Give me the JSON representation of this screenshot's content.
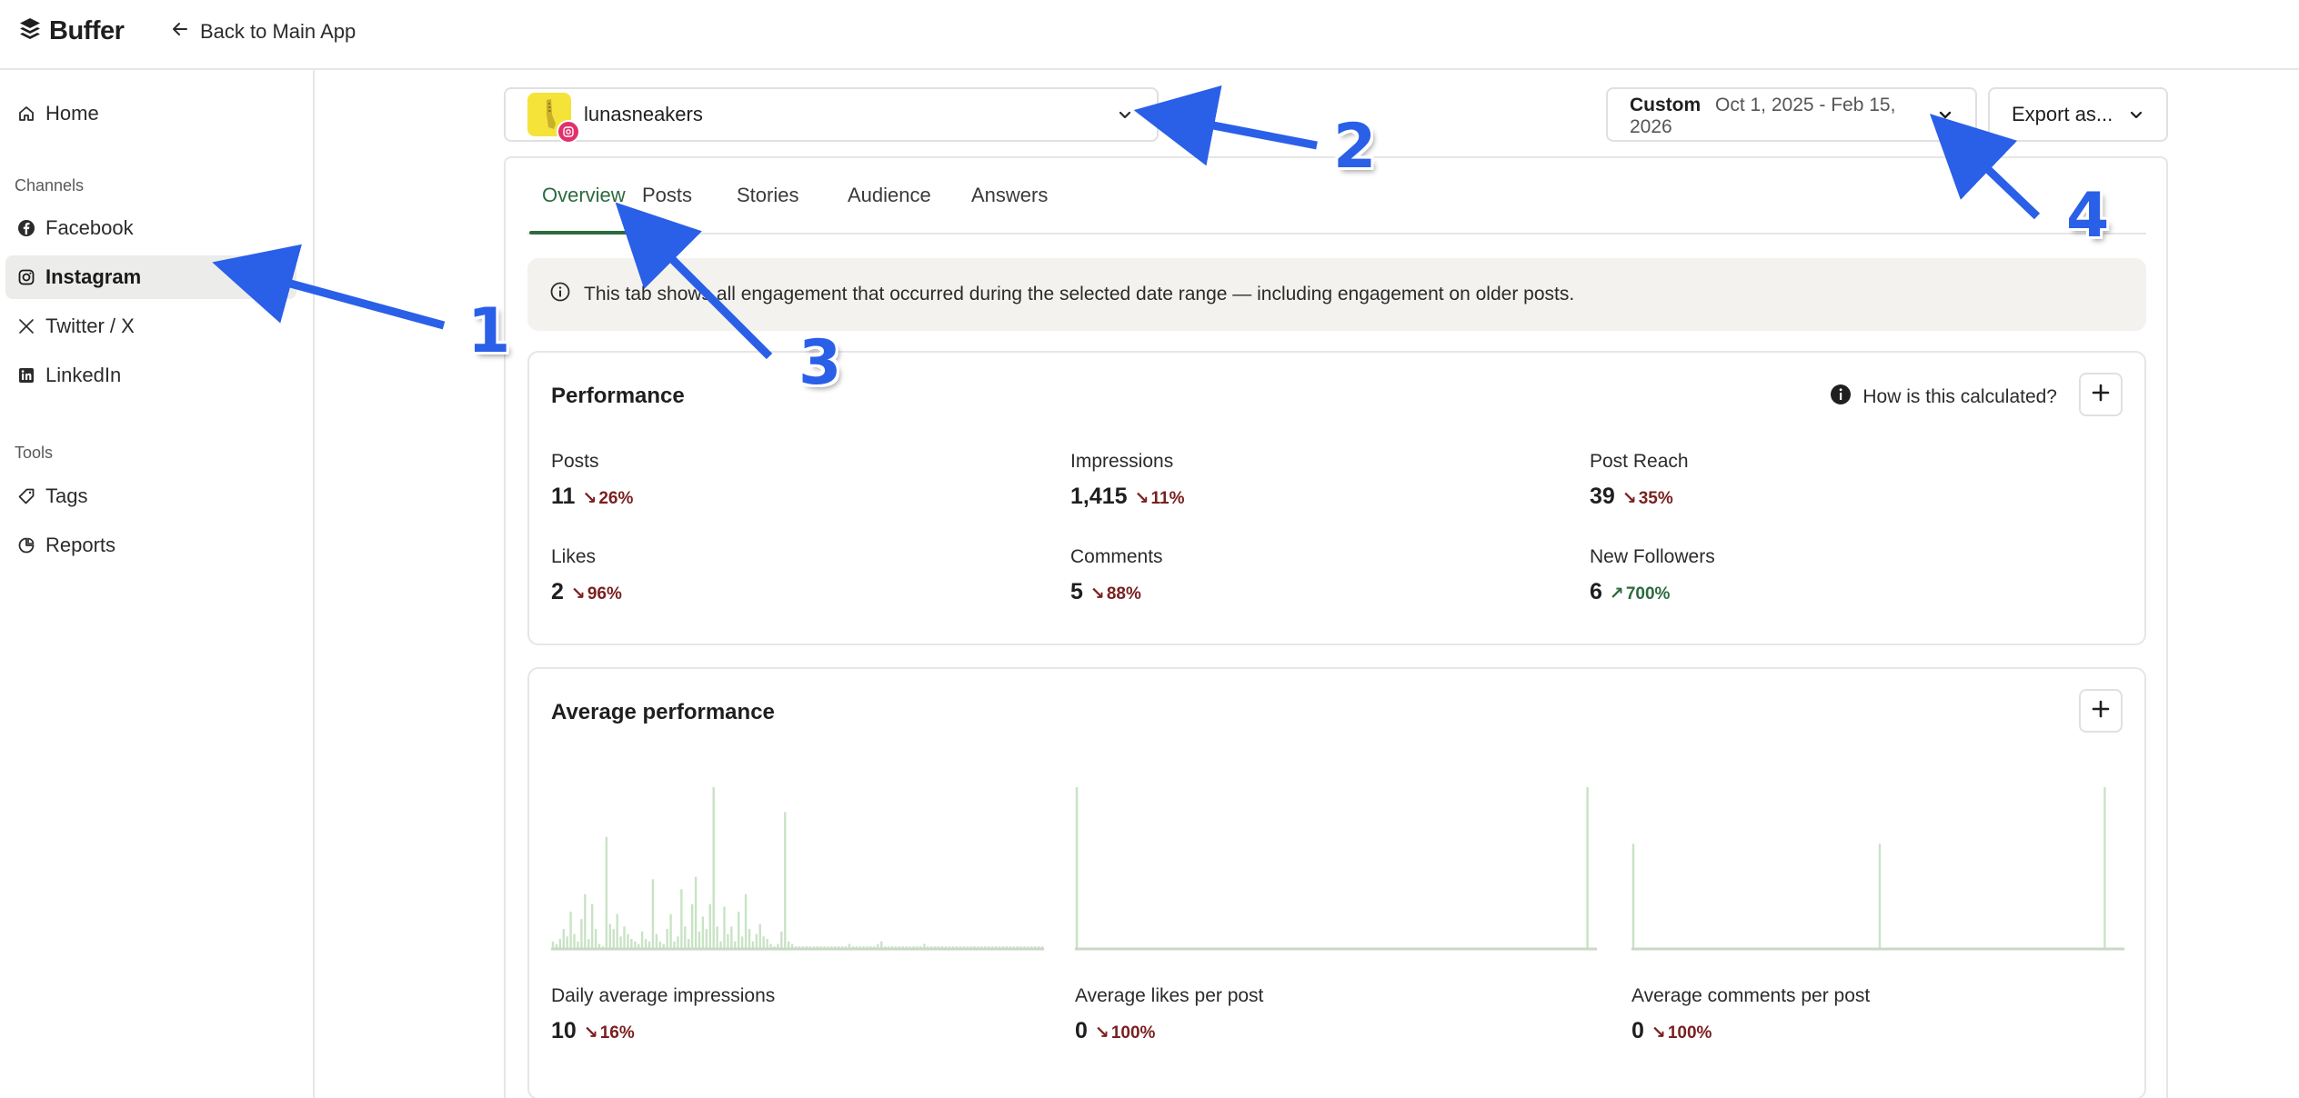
{
  "header": {
    "logo_text": "Buffer",
    "back_label": "Back to Main App"
  },
  "sidebar": {
    "home_label": "Home",
    "channels_heading": "Channels",
    "channels": [
      {
        "label": "Facebook",
        "icon": "facebook-icon"
      },
      {
        "label": "Instagram",
        "icon": "instagram-icon",
        "active": true
      },
      {
        "label": "Twitter / X",
        "icon": "x-icon"
      },
      {
        "label": "LinkedIn",
        "icon": "linkedin-icon"
      }
    ],
    "tools_heading": "Tools",
    "tools": [
      {
        "label": "Tags",
        "icon": "tag-icon"
      },
      {
        "label": "Reports",
        "icon": "pie-chart-icon"
      }
    ]
  },
  "channel_select": {
    "name": "lunasneakers"
  },
  "date_select": {
    "label": "Custom",
    "range_line1": "Oct 1, 2025 - Feb 15,",
    "range_line2": "2026"
  },
  "export": {
    "label": "Export as..."
  },
  "tabs": [
    {
      "label": "Overview",
      "active": true
    },
    {
      "label": "Posts"
    },
    {
      "label": "Stories"
    },
    {
      "label": "Audience"
    },
    {
      "label": "Answers"
    }
  ],
  "notice": {
    "text": "This tab shows all engagement that occurred during the selected date range — including engagement on older posts."
  },
  "performance": {
    "title": "Performance",
    "how_calculated": "How is this calculated?",
    "metrics": [
      {
        "label": "Posts",
        "value": "11",
        "change": "26%",
        "direction": "down"
      },
      {
        "label": "Impressions",
        "value": "1,415",
        "change": "11%",
        "direction": "down"
      },
      {
        "label": "Post Reach",
        "value": "39",
        "change": "35%",
        "direction": "down"
      },
      {
        "label": "Likes",
        "value": "2",
        "change": "96%",
        "direction": "down"
      },
      {
        "label": "Comments",
        "value": "5",
        "change": "88%",
        "direction": "down"
      },
      {
        "label": "New Followers",
        "value": "6",
        "change": "700%",
        "direction": "up"
      }
    ]
  },
  "average_performance": {
    "title": "Average performance",
    "charts": [
      {
        "label": "Daily average impressions",
        "value": "10",
        "change": "16%",
        "direction": "down"
      },
      {
        "label": "Average likes per post",
        "value": "0",
        "change": "100%",
        "direction": "down"
      },
      {
        "label": "Average comments per post",
        "value": "0",
        "change": "100%",
        "direction": "down"
      }
    ]
  },
  "chart_data": [
    {
      "type": "bar",
      "title": "Daily average impressions",
      "values": [
        3,
        2,
        4,
        8,
        5,
        15,
        6,
        3,
        12,
        22,
        4,
        18,
        8,
        2,
        1,
        45,
        10,
        8,
        14,
        5,
        9,
        6,
        4,
        3,
        2,
        7,
        4,
        3,
        28,
        6,
        3,
        2,
        8,
        14,
        3,
        5,
        24,
        9,
        4,
        18,
        29,
        7,
        13,
        8,
        18,
        65,
        9,
        3,
        17,
        6,
        9,
        3,
        15,
        5,
        22,
        8,
        3,
        6,
        10,
        5,
        4,
        2,
        1,
        2,
        7,
        55,
        3,
        2,
        1,
        1,
        1,
        1,
        1,
        1,
        1,
        1,
        1,
        1,
        1,
        1,
        1,
        1,
        1,
        2,
        1,
        1,
        1,
        1,
        1,
        1,
        1,
        2,
        3,
        1,
        1,
        1,
        1,
        1,
        1,
        1,
        1,
        1,
        1,
        1,
        2,
        1,
        1,
        1,
        1,
        1,
        1,
        1,
        1,
        1,
        1,
        1,
        1,
        1,
        1,
        1,
        1,
        1,
        1,
        1,
        1,
        1,
        1,
        1,
        1,
        1,
        1,
        1,
        1,
        1,
        1,
        1,
        1,
        1
      ]
    },
    {
      "type": "bar",
      "title": "Average likes per post",
      "values": [
        1,
        0,
        0,
        0,
        0,
        0,
        0,
        0,
        0,
        0,
        0,
        0,
        0,
        0,
        0,
        0,
        0,
        0,
        0,
        0,
        0,
        0,
        0,
        0,
        0,
        0,
        0,
        0,
        0,
        0,
        0,
        0,
        0,
        0,
        0,
        0,
        0,
        0,
        0,
        0,
        0,
        0,
        0,
        0,
        0,
        0,
        0,
        0,
        0,
        0,
        0,
        0,
        0,
        0,
        0,
        0,
        0,
        0,
        0,
        0,
        0,
        0,
        0,
        0,
        0,
        0,
        0,
        0,
        0,
        0,
        0,
        0,
        0,
        0,
        0,
        0,
        0,
        0,
        0,
        0,
        0,
        0,
        0,
        0,
        0,
        0,
        0,
        0,
        0,
        0,
        0,
        0,
        0,
        0,
        0,
        0,
        0,
        0,
        0,
        0,
        0,
        0,
        0,
        0,
        0,
        0,
        0,
        0,
        0,
        0,
        0,
        0,
        0,
        0,
        0,
        0,
        0,
        0,
        0,
        0,
        0,
        0,
        0,
        0,
        0,
        0,
        0,
        0,
        0,
        0,
        0,
        0,
        0,
        0,
        0,
        1,
        0,
        0
      ]
    },
    {
      "type": "bar",
      "title": "Average comments per post",
      "values": [
        0.65,
        0,
        0,
        0,
        0,
        0,
        0,
        0,
        0,
        0,
        0,
        0,
        0,
        0,
        0,
        0,
        0,
        0,
        0,
        0,
        0,
        0,
        0,
        0,
        0,
        0,
        0,
        0,
        0,
        0,
        0,
        0,
        0,
        0,
        0,
        0,
        0,
        0,
        0,
        0,
        0,
        0,
        0,
        0,
        0,
        0,
        0,
        0,
        0,
        0,
        0,
        0,
        0,
        0,
        0,
        0,
        0,
        0,
        0,
        0,
        0,
        0,
        0,
        0,
        0,
        0,
        0,
        0,
        0,
        0.65,
        0,
        0,
        0,
        0,
        0,
        0,
        0,
        0,
        0,
        0,
        0,
        0,
        0,
        0,
        0,
        0,
        0,
        0,
        0,
        0,
        0,
        0,
        0,
        0,
        0,
        0,
        0,
        0,
        0,
        0,
        0,
        0,
        0,
        0,
        0,
        0,
        0,
        0,
        0,
        0,
        0,
        0,
        0,
        0,
        0,
        0,
        0,
        0,
        0,
        0,
        0,
        0,
        0,
        0,
        0,
        0,
        0,
        0,
        0,
        0,
        0,
        0,
        1,
        0,
        0,
        0,
        0,
        0
      ]
    }
  ],
  "annotations": [
    "1",
    "2",
    "3",
    "4"
  ],
  "colors": {
    "accent_green": "#2d6a3e",
    "down_red": "#7a1f1f",
    "bar_green": "#c8e3c4",
    "annotation_blue": "#2a5fe8",
    "instagram_pink": "#e1306c"
  }
}
